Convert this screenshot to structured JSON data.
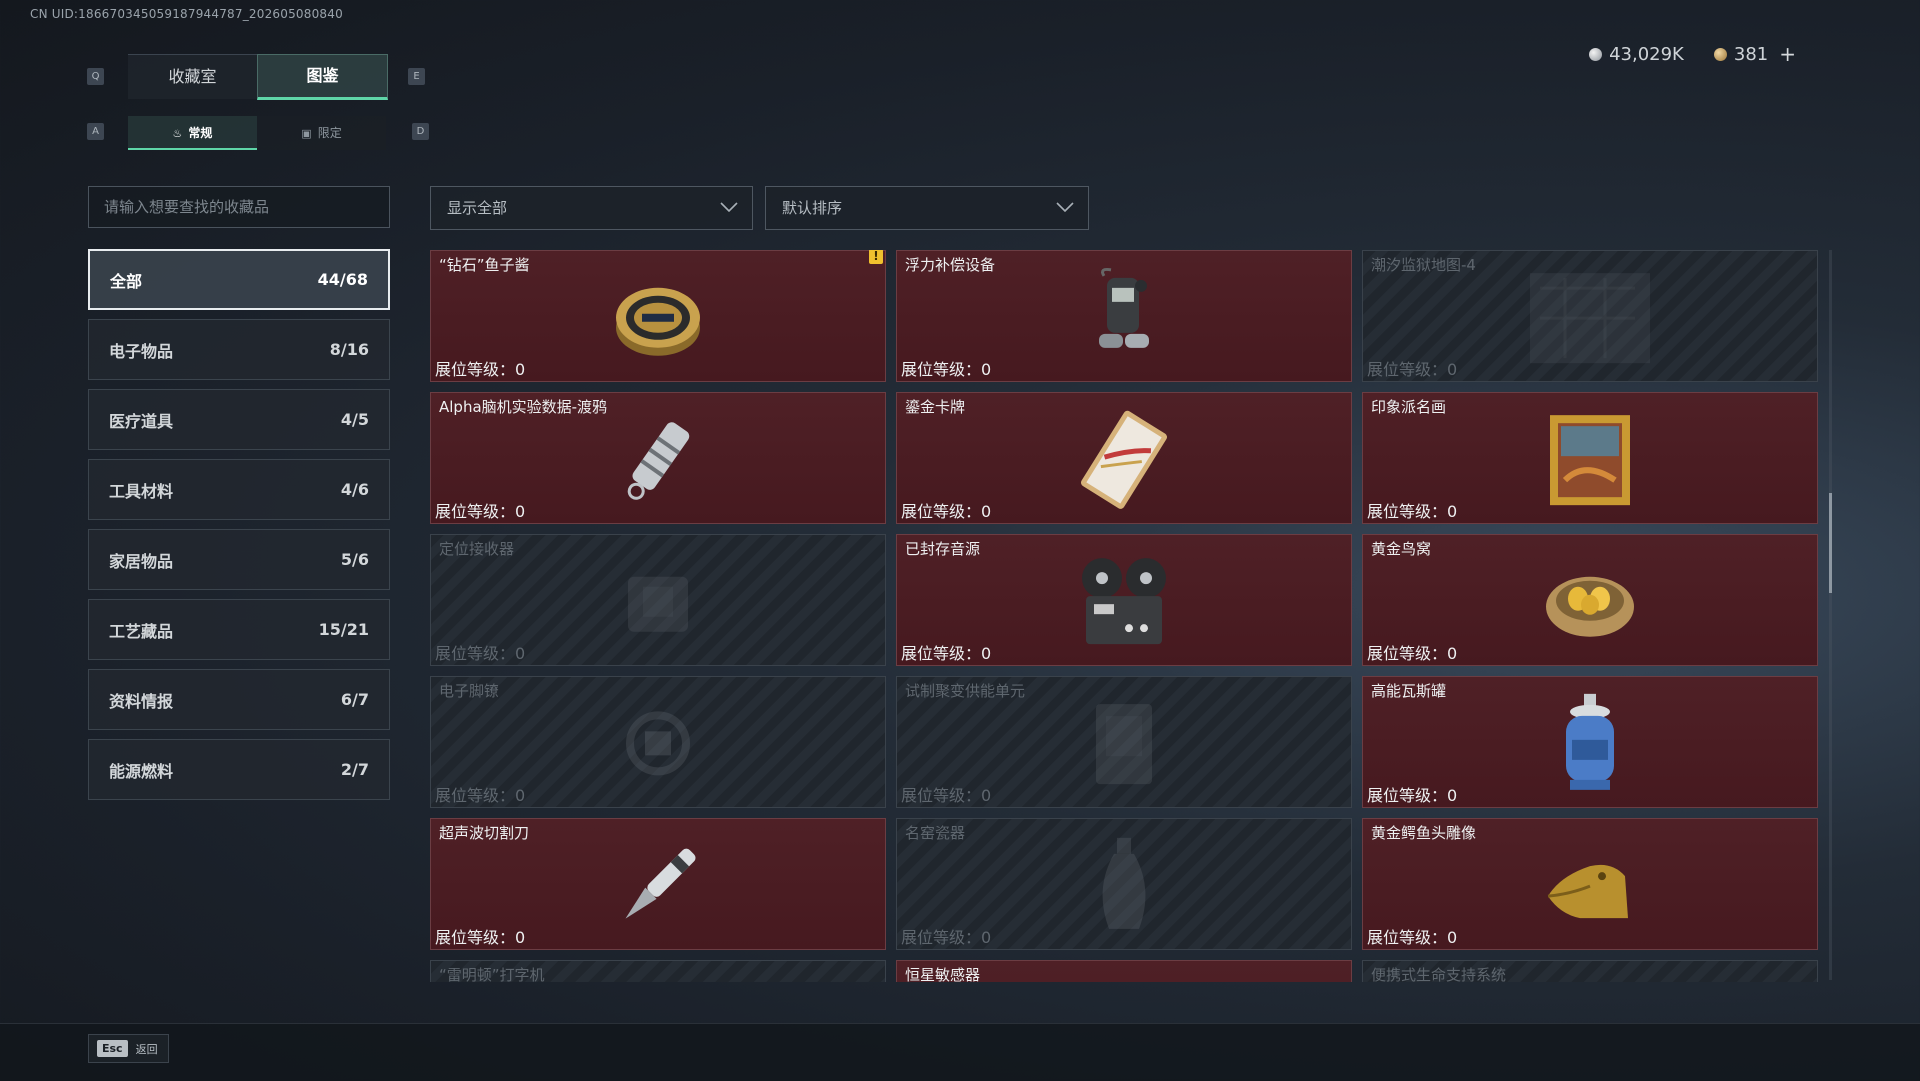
{
  "uid": "CN UID:18667034505918794478​7_202605080840",
  "currency": {
    "silver": "43,029K",
    "gold": "381",
    "plus": "+"
  },
  "keys": {
    "q": "Q",
    "e": "E",
    "a": "A",
    "d": "D"
  },
  "tabs": {
    "collection": "收藏室",
    "atlas": "图鉴"
  },
  "subtabs": {
    "regular": "常规",
    "limited": "限定"
  },
  "search": {
    "placeholder": "请输入想要查找的收藏品"
  },
  "filters": {
    "show": "显示全部",
    "sort": "默认排序"
  },
  "categories": [
    {
      "label": "全部",
      "count": "44/68"
    },
    {
      "label": "电子物品",
      "count": "8/16"
    },
    {
      "label": "医疗道具",
      "count": "4/5"
    },
    {
      "label": "工具材料",
      "count": "4/6"
    },
    {
      "label": "家居物品",
      "count": "5/6"
    },
    {
      "label": "工艺藏品",
      "count": "15/21"
    },
    {
      "label": "资料情报",
      "count": "6/7"
    },
    {
      "label": "能源燃料",
      "count": "2/7"
    }
  ],
  "level_label": "展位等级：",
  "items": [
    {
      "name": "“钻石”鱼子酱",
      "level": "0",
      "owned": true,
      "icon": "caviar-tin-icon",
      "warn": "!"
    },
    {
      "name": "浮力补偿设备",
      "level": "0",
      "owned": true,
      "icon": "buoyancy-device-icon"
    },
    {
      "name": "潮汐监狱地图-4",
      "level": "0",
      "owned": false,
      "icon": "map-icon"
    },
    {
      "name": "Alpha脑机实验数据-渡鸦",
      "level": "0",
      "owned": true,
      "icon": "usb-drive-icon"
    },
    {
      "name": "鎏金卡牌",
      "level": "0",
      "owned": true,
      "icon": "gilded-card-icon"
    },
    {
      "name": "印象派名画",
      "level": "0",
      "owned": true,
      "icon": "painting-icon"
    },
    {
      "name": "定位接收器",
      "level": "0",
      "owned": false,
      "icon": "receiver-icon"
    },
    {
      "name": "已封存音源",
      "level": "0",
      "owned": true,
      "icon": "reel-recorder-icon"
    },
    {
      "name": "黄金鸟窝",
      "level": "0",
      "owned": true,
      "icon": "golden-nest-icon"
    },
    {
      "name": "电子脚镣",
      "level": "0",
      "owned": false,
      "icon": "ankle-monitor-icon"
    },
    {
      "name": "试制聚变供能单元",
      "level": "0",
      "owned": false,
      "icon": "fusion-unit-icon"
    },
    {
      "name": "高能瓦斯罐",
      "level": "0",
      "owned": true,
      "icon": "gas-canister-icon"
    },
    {
      "name": "超声波切割刀",
      "level": "0",
      "owned": true,
      "icon": "ultrasonic-cutter-icon"
    },
    {
      "name": "名窑瓷器",
      "level": "0",
      "owned": false,
      "icon": "porcelain-vase-icon"
    },
    {
      "name": "黄金鳄鱼头雕像",
      "level": "0",
      "owned": true,
      "icon": "gold-crocodile-icon"
    },
    {
      "name": "“雷明顿”打字机",
      "level": "",
      "owned": false,
      "icon": "typewriter-icon"
    },
    {
      "name": "恒星敏感器",
      "level": "",
      "owned": true,
      "icon": "star-sensor-icon"
    },
    {
      "name": "便携式生命支持系统",
      "level": "",
      "owned": false,
      "icon": "life-support-icon"
    }
  ],
  "footer": {
    "esc_key": "Esc",
    "back_label": "返回"
  },
  "colors": {
    "accent": "#5fd6a8",
    "owned_card": "#4f2026",
    "warning": "#f0c12e"
  }
}
